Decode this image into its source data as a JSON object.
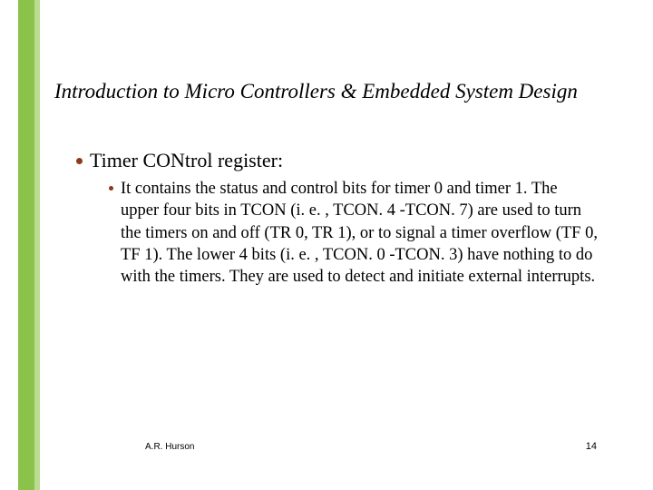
{
  "slide": {
    "title": "Introduction to Micro Controllers & Embedded System Design",
    "main_bullet": "Timer CONtrol register:",
    "sub_bullet": "It contains the status and control bits for timer 0 and timer 1.  The upper four bits in TCON (i. e. , TCON. 4 -TCON. 7) are used to turn the timers on and off (TR 0, TR 1), or to signal a timer overflow (TF 0, TF 1).  The lower 4 bits (i. e. , TCON. 0 -TCON. 3) have nothing to do with the timers.  They are used to detect and initiate external interrupts."
  },
  "footer": {
    "author": "A.R. Hurson",
    "page": "14"
  }
}
